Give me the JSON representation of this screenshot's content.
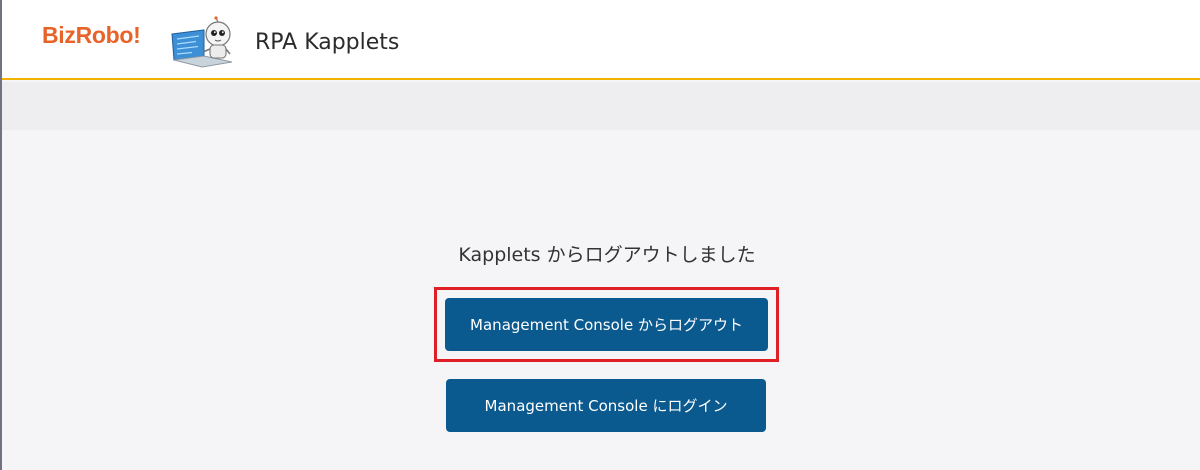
{
  "header": {
    "brand": "BizRobo!",
    "app_title": "RPA Kapplets",
    "mascot_icon": "robot-mascot-icon"
  },
  "main": {
    "message": "Kapplets からログアウトしました",
    "logout_button_label": "Management Console からログアウト",
    "login_button_label": "Management Console にログイン"
  },
  "colors": {
    "brand": "#e8632a",
    "accent_border": "#f0b400",
    "button": "#0b5a8f",
    "highlight": "#e01e26"
  }
}
